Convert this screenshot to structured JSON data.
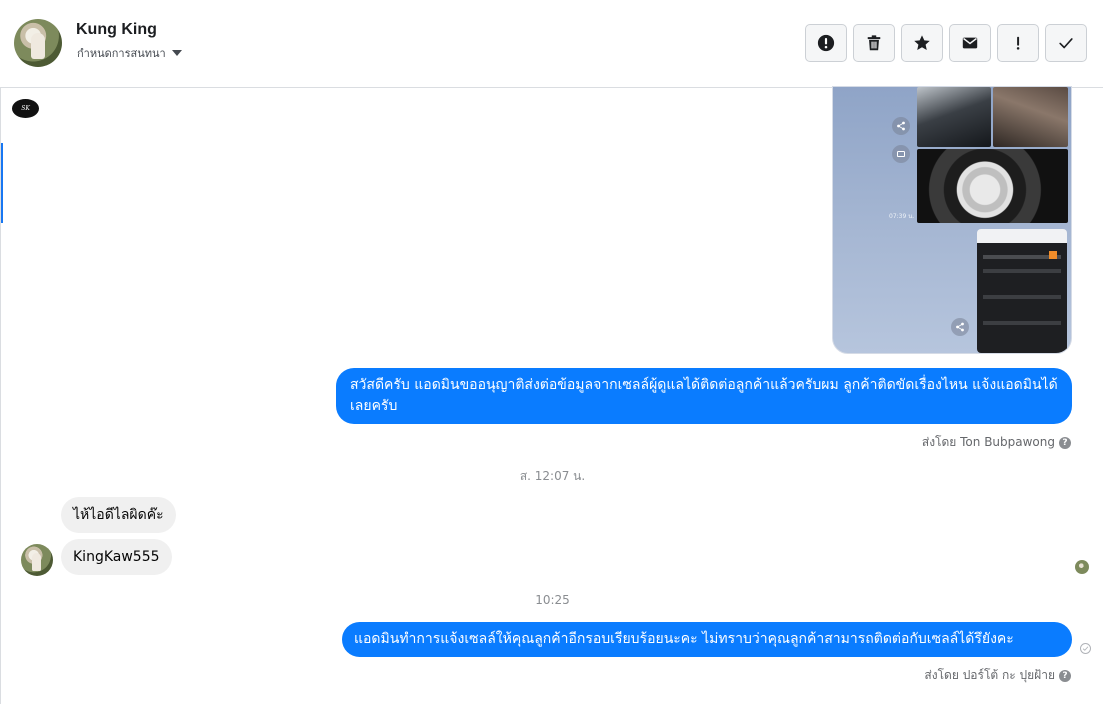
{
  "header": {
    "contact_name": "Kung King",
    "conversation_setting": "กำหนดการสนทนา",
    "toolbar": [
      {
        "name": "report-button",
        "icon": "exclamation-circle-icon"
      },
      {
        "name": "delete-button",
        "icon": "trash-icon"
      },
      {
        "name": "star-button",
        "icon": "star-icon"
      },
      {
        "name": "mark-unread-button",
        "icon": "envelope-icon"
      },
      {
        "name": "follow-up-button",
        "icon": "exclamation-icon"
      },
      {
        "name": "mark-done-button",
        "icon": "checkmark-icon"
      }
    ]
  },
  "thread": {
    "page_logo_text": "SK",
    "attachment": {
      "timestamp_overlay": "07:39 น."
    },
    "messages": [
      {
        "direction": "outgoing",
        "text": "สวัสดีครับ แอดมินขออนุญาติส่งต่อข้อมูลจากเซลล์ผู้ดูแลได้ติดต่อลูกค้าแล้วครับผม ลูกค้าติดขัดเรื่องไหน แจ้งแอดมินได้เลยครับ",
        "sent_by": "ส่งโดย Ton Bubpawong"
      },
      {
        "direction": "timestamp",
        "text": "ส. 12:07 น."
      },
      {
        "direction": "incoming",
        "text": "ไห้ไอดีไลผิดค๊ะ"
      },
      {
        "direction": "incoming",
        "text": "KingKaw555"
      },
      {
        "direction": "timestamp",
        "text": "10:25"
      },
      {
        "direction": "outgoing",
        "text": "แอดมินทำการแจ้งเซลล์ให้คุณลูกค้าอีกรอบเรียบร้อยนะคะ ไม่ทราบว่าคุณลูกค้าสามารถติดต่อกับเซลล์ได้รึยังคะ",
        "sent_by": "ส่งโดย ปอร์โต้ กะ ปุยฝ้าย"
      }
    ]
  },
  "colors": {
    "outgoing_bubble": "#0a7cff",
    "incoming_bubble": "#f0f0f0",
    "accent": "#1877f2"
  }
}
